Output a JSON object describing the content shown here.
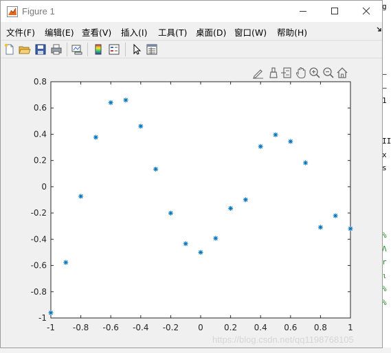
{
  "window": {
    "title": "Figure 1"
  },
  "menubar": [
    {
      "id": "file",
      "label": "文件(F)"
    },
    {
      "id": "edit",
      "label": "编辑(E)"
    },
    {
      "id": "view",
      "label": "查看(V)"
    },
    {
      "id": "insert",
      "label": "插入(I)"
    },
    {
      "id": "tools",
      "label": "工具(T)"
    },
    {
      "id": "desktop",
      "label": "桌面(D)"
    },
    {
      "id": "window",
      "label": "窗口(W)"
    },
    {
      "id": "help",
      "label": "帮助(H)"
    }
  ],
  "toolbar_icons": [
    "new-figure-icon",
    "open-file-icon",
    "save-icon",
    "print-icon",
    "link-plot-icon",
    "insert-colorbar-icon",
    "insert-legend-icon",
    "edit-plot-arrow-icon",
    "property-inspector-icon"
  ],
  "axes_toolbar_icons": [
    "edit-pen-icon",
    "brush-icon",
    "data-tips-icon",
    "pan-hand-icon",
    "zoom-in-icon",
    "zoom-out-icon",
    "home-icon"
  ],
  "colors": {
    "marker": "#0072bd",
    "axes": "#262626",
    "figure_bg": "#f0f0f0"
  },
  "chart_data": {
    "type": "scatter",
    "marker": "*",
    "x": [
      -1,
      -0.9,
      -0.8,
      -0.7,
      -0.6,
      -0.5,
      -0.4,
      -0.3,
      -0.2,
      -0.1,
      0,
      0.1,
      0.2,
      0.3,
      0.4,
      0.5,
      0.6,
      0.7,
      0.8,
      0.9,
      1
    ],
    "y": [
      -0.96,
      -0.577,
      -0.073,
      0.377,
      0.641,
      0.66,
      0.461,
      0.134,
      -0.201,
      -0.434,
      -0.5,
      -0.393,
      -0.165,
      -0.099,
      0.307,
      0.396,
      0.345,
      0.182,
      -0.309,
      -0.221,
      -0.32
    ],
    "xlim": [
      -1,
      1
    ],
    "ylim": [
      -1,
      0.8
    ],
    "xticks": [
      "-1",
      "-0.8",
      "-0.6",
      "-0.4",
      "-0.2",
      "0",
      "0.2",
      "0.4",
      "0.6",
      "0.8",
      "1"
    ],
    "yticks": [
      "0.8",
      "0.6",
      "0.4",
      "0.2",
      "0",
      "-0.2",
      "-0.4",
      "-0.6",
      "-0.8",
      "-1"
    ],
    "xtick_values": [
      -1,
      -0.8,
      -0.6,
      -0.4,
      -0.2,
      0,
      0.2,
      0.4,
      0.6,
      0.8,
      1
    ],
    "ytick_values": [
      0.8,
      0.6,
      0.4,
      0.2,
      0,
      -0.2,
      -0.4,
      -0.6,
      -0.8,
      -1
    ],
    "title": "",
    "xlabel": "",
    "ylabel": "",
    "grid": false
  },
  "watermark": "https://blog.csdn.net/qq1198768105",
  "background_editor_lines": [
    "g",
    "",
    "",
    "",
    "",
    "–",
    "–",
    "1",
    "",
    "",
    "II",
    "x",
    "s",
    "",
    "",
    "",
    "",
    "%",
    "Λ",
    "r",
    "ι",
    "%",
    "%"
  ]
}
